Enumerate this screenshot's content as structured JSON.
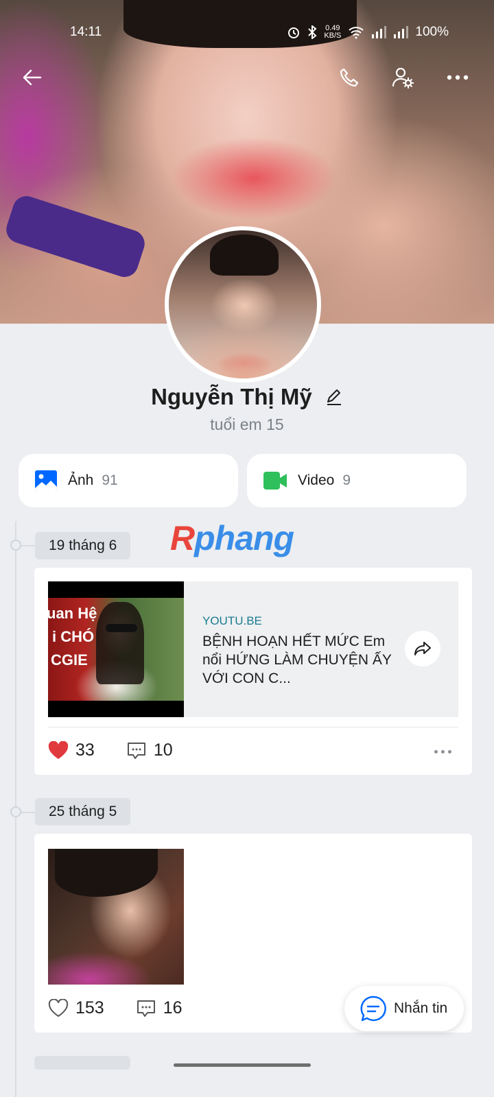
{
  "status_bar": {
    "time": "14:11",
    "net_speed_value": "0.49",
    "net_speed_unit": "KB/S",
    "battery": "100%"
  },
  "profile": {
    "name": "Nguyễn Thị Mỹ",
    "subtitle": "tuổi em 15"
  },
  "media": {
    "photos_label": "Ảnh",
    "photos_count": "91",
    "videos_label": "Video",
    "videos_count": "9"
  },
  "watermark": {
    "first_letter": "R",
    "rest": "phang"
  },
  "timeline": [
    {
      "date": "19 tháng 6",
      "link": {
        "source": "YOUTU.BE",
        "title": "BỆNH HOẠN HẾT MỨC Em nổi HỨNG LÀM CHUYỆN ẤY VỚI CON C...",
        "thumb_line1": "uan Hệ",
        "thumb_line2": "i CHÓ",
        "thumb_line3": "CGIE"
      },
      "likes": "33",
      "comments": "10"
    },
    {
      "date": "25 tháng 5",
      "likes": "153",
      "comments": "16"
    }
  ],
  "message_button": {
    "label": "Nhắn tin"
  },
  "colors": {
    "accent_blue": "#0068ff",
    "video_green": "#2fbf5b",
    "like_red": "#e03a3e",
    "link_source": "#1a7a8f"
  },
  "icons": [
    "back-arrow-icon",
    "phone-icon",
    "user-settings-icon",
    "more-icon",
    "edit-pencil-icon",
    "photo-icon",
    "video-camera-icon",
    "share-icon",
    "heart-icon",
    "comment-icon",
    "chat-bubble-icon"
  ]
}
